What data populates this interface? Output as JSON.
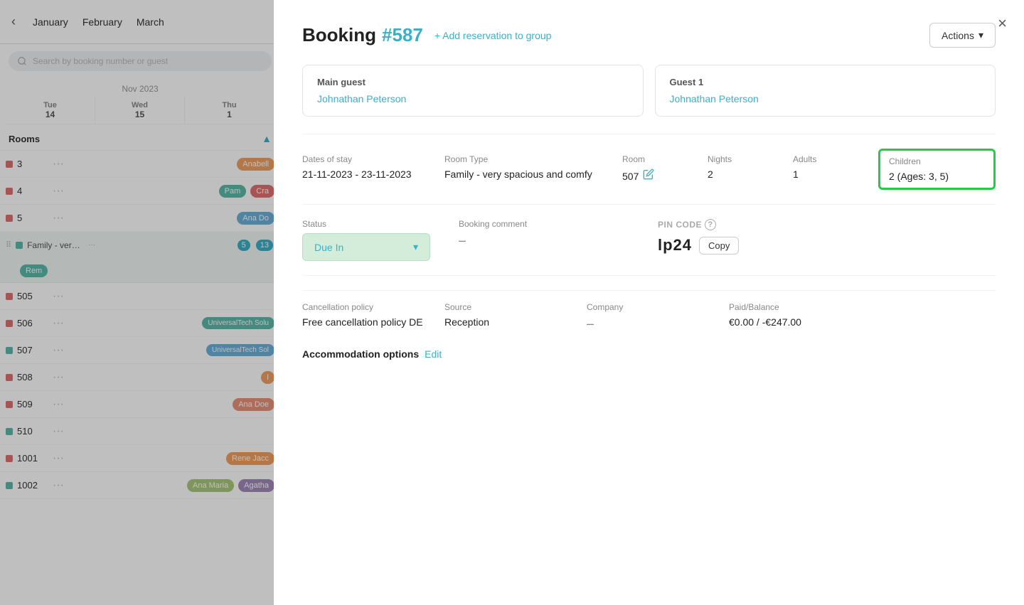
{
  "calendar": {
    "months": [
      "January",
      "February",
      "March"
    ],
    "search_placeholder": "Search by booking number or guest",
    "period_label": "Nov 2023",
    "days": [
      {
        "name": "Tue",
        "num": "14"
      },
      {
        "name": "Wed",
        "num": "15"
      },
      {
        "name": "Thu",
        "num": "1"
      }
    ],
    "rooms_label": "Rooms",
    "rooms": [
      {
        "num": "3",
        "dot": "red",
        "chip_text": "Anabell",
        "chip_color": "orange"
      },
      {
        "num": "4",
        "dot": "red",
        "chip1": "Pam",
        "chip1_color": "teal",
        "chip2": "Cra",
        "chip2_color": "pink"
      },
      {
        "num": "5",
        "dot": "red",
        "chip_text": "Ana Do",
        "chip_color": "blue"
      },
      {
        "num": "Family - very s...",
        "dot": null,
        "chips": [
          "5",
          "13",
          ""
        ],
        "is_family": true,
        "sub_chip": "Rem"
      },
      {
        "num": "505",
        "dot": "red"
      },
      {
        "num": "506",
        "dot": "red",
        "chip_text": "UniversalTech Solu",
        "chip_color": "teal"
      },
      {
        "num": "507",
        "dot": "teal",
        "chip_text": "UniversalTech Sol",
        "chip_color": "blue"
      },
      {
        "num": "508",
        "dot": "red",
        "chip_text": "I",
        "chip_color": "orange"
      },
      {
        "num": "509",
        "dot": "red",
        "chip_text": "Ana Doe",
        "chip_color": "salmon"
      },
      {
        "num": "510",
        "dot": "teal"
      },
      {
        "num": "1001",
        "dot": "red",
        "chip_text": "Rene Jacc",
        "chip_color": "orange"
      },
      {
        "num": "1002",
        "dot": "teal",
        "chip1": "Ana Maria",
        "chip1_color": "lime",
        "chip2": "Agatha",
        "chip2_color": "purple"
      }
    ]
  },
  "booking": {
    "title": "Booking",
    "number": "#587",
    "add_group_label": "+ Add reservation to group",
    "actions_label": "Actions",
    "main_guest_label": "Main guest",
    "main_guest_name": "Johnathan Peterson",
    "guest1_label": "Guest 1",
    "guest1_name": "Johnathan Peterson",
    "dates_label": "Dates of stay",
    "dates_value": "21-11-2023 - 23-11-2023",
    "room_type_label": "Room Type",
    "room_type_value": "Family - very spacious and comfy",
    "room_label": "Room",
    "room_value": "507",
    "nights_label": "Nights",
    "nights_value": "2",
    "adults_label": "Adults",
    "adults_value": "1",
    "children_label": "Children",
    "children_value": "2 (Ages: 3, 5)",
    "status_label": "Status",
    "status_value": "Due In",
    "booking_comment_label": "Booking comment",
    "booking_comment_value": "–",
    "pin_code_label": "PIN CODE",
    "pin_code_value": "lp24",
    "copy_label": "Copy",
    "cancellation_label": "Cancellation policy",
    "cancellation_value": "Free cancellation policy DE",
    "source_label": "Source",
    "source_value": "Reception",
    "company_label": "Company",
    "company_value": "–",
    "paid_balance_label": "Paid/Balance",
    "paid_balance_value": "€0.00 / -€247.00",
    "accommodation_label": "Accommodation options",
    "edit_label": "Edit",
    "close_label": "×"
  }
}
